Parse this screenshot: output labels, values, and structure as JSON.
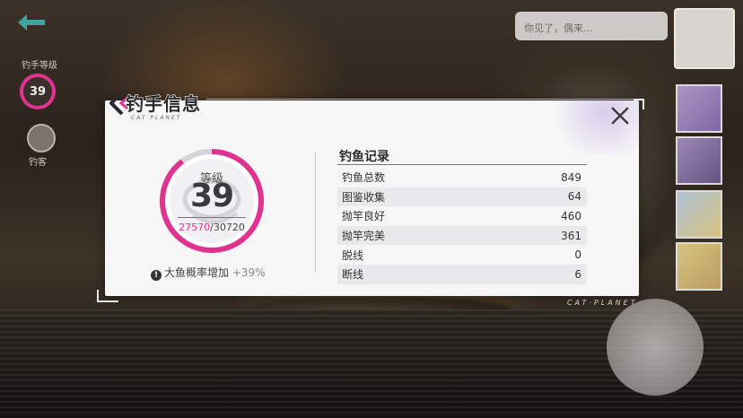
{
  "hud": {
    "level_label": "钓手等级",
    "level_value": "39",
    "button_label": "钓客",
    "chat_text": "你见了，偶来..."
  },
  "background_text": {
    "brand_small": "CAT·PLANET"
  },
  "panel": {
    "title": "钓手信息",
    "subtitle": "CAT·PLANET",
    "level": {
      "label": "等级",
      "value": "39",
      "exp_current": "27570",
      "exp_separator": "/",
      "exp_max": "30720",
      "exp_fraction": 0.8975
    },
    "bonus": {
      "icon": "warning-icon",
      "text": "大鱼概率增加",
      "value": "+39%"
    },
    "records": {
      "title": "钓鱼记录",
      "rows": [
        {
          "label": "钓鱼总数",
          "value": "849"
        },
        {
          "label": "图鉴收集",
          "value": "64"
        },
        {
          "label": "抛竿良好",
          "value": "460"
        },
        {
          "label": "抛竿完美",
          "value": "361"
        },
        {
          "label": "脱线",
          "value": "0"
        },
        {
          "label": "断线",
          "value": "6"
        }
      ]
    }
  },
  "colors": {
    "accent": "#e0338f",
    "panel_bg": "#f6f6f7",
    "text": "#333333"
  }
}
